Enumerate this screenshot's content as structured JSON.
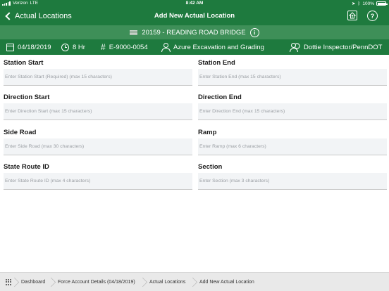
{
  "status": {
    "carrier": "Verizon",
    "network": "LTE",
    "time": "8:42 AM",
    "battery": "100%",
    "battery_level": 1.0
  },
  "nav": {
    "back_label": "Actual Locations",
    "title": "Add New Actual Location",
    "home_icon": "home-upload-icon",
    "help_icon": "help-icon",
    "help_glyph": "?"
  },
  "project": {
    "name": "20159 - READING ROAD BRIDGE",
    "info_glyph": "i"
  },
  "info": {
    "date": "04/18/2019",
    "hours": "8 Hr",
    "contract": "E-9000-0054",
    "contractor": "Azure Excavation and Grading",
    "inspector": "Dottie Inspector/PennDOT",
    "hash_glyph": "#"
  },
  "form": {
    "station_start": {
      "label": "Station Start",
      "placeholder": "Enter Station Start (Required) (max 15 characters)",
      "value": ""
    },
    "station_end": {
      "label": "Station End",
      "placeholder": "Enter Station End (max 15 characters)",
      "value": ""
    },
    "direction_start": {
      "label": "Direction Start",
      "placeholder": "Enter Direction Start (max 15 characters)",
      "value": ""
    },
    "direction_end": {
      "label": "Direction End",
      "placeholder": "Enter Direction End (max 15 characters)",
      "value": ""
    },
    "side_road": {
      "label": "Side Road",
      "placeholder": "Enter Side Road (max 30 characters)",
      "value": ""
    },
    "ramp": {
      "label": "Ramp",
      "placeholder": "Enter Ramp (max 6 characters)",
      "value": ""
    },
    "state_route_id": {
      "label": "State Route ID",
      "placeholder": "Enter State Route ID (max 4 characters)",
      "value": ""
    },
    "section": {
      "label": "Section",
      "placeholder": "Enter Section (max 3 characters)",
      "value": ""
    }
  },
  "breadcrumb": {
    "items": [
      "Dashboard",
      "Force Account Details (04/18/2019)",
      "Actual Locations",
      "Add New Actual Location"
    ]
  },
  "colors": {
    "primary_green": "#1e7a3e",
    "secondary_green": "#3e8f58",
    "input_bg": "#f2f4f6"
  }
}
